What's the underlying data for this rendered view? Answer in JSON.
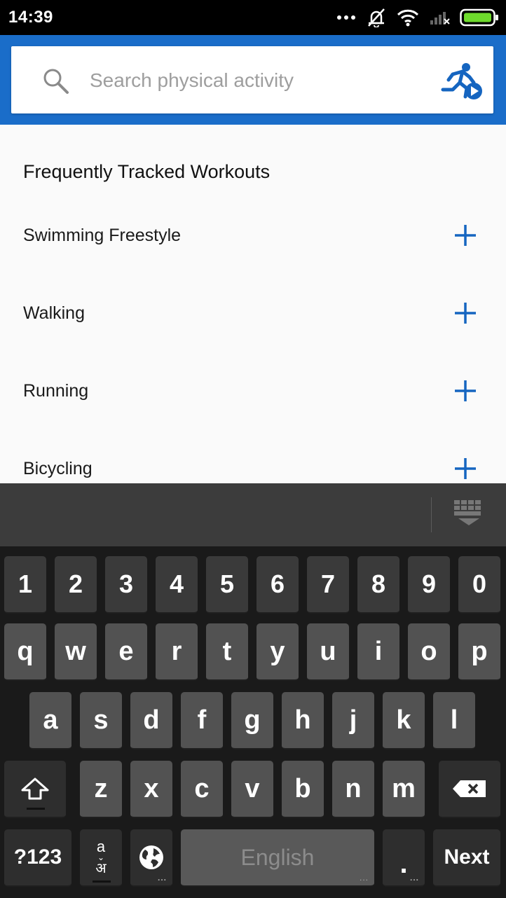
{
  "status_bar": {
    "time": "14:39",
    "icons": [
      "more-dots-icon",
      "vibrate-off-icon",
      "wifi-icon",
      "signal-off-icon",
      "battery-icon"
    ]
  },
  "search": {
    "placeholder": "Search physical activity",
    "value": ""
  },
  "workouts": {
    "title": "Frequently Tracked Workouts",
    "items": [
      {
        "label": "Swimming Freestyle"
      },
      {
        "label": "Walking"
      },
      {
        "label": "Running"
      },
      {
        "label": "Bicycling"
      }
    ]
  },
  "keyboard": {
    "numbers": [
      "1",
      "2",
      "3",
      "4",
      "5",
      "6",
      "7",
      "8",
      "9",
      "0"
    ],
    "row1": [
      "q",
      "w",
      "e",
      "r",
      "t",
      "y",
      "u",
      "i",
      "o",
      "p"
    ],
    "row2": [
      "a",
      "s",
      "d",
      "f",
      "g",
      "h",
      "j",
      "k",
      "l"
    ],
    "row3": [
      "z",
      "x",
      "c",
      "v",
      "b",
      "n",
      "m"
    ],
    "symbols_label": "?123",
    "lang_switch": {
      "latin": "a",
      "devanagari": "अ"
    },
    "space_label": "English",
    "period": ".",
    "action_label": "Next",
    "key_hint_dots": "..."
  },
  "colors": {
    "brand_blue": "#1a6dc9",
    "plus_blue": "#1565c0",
    "battery_green": "#6edb2c"
  }
}
